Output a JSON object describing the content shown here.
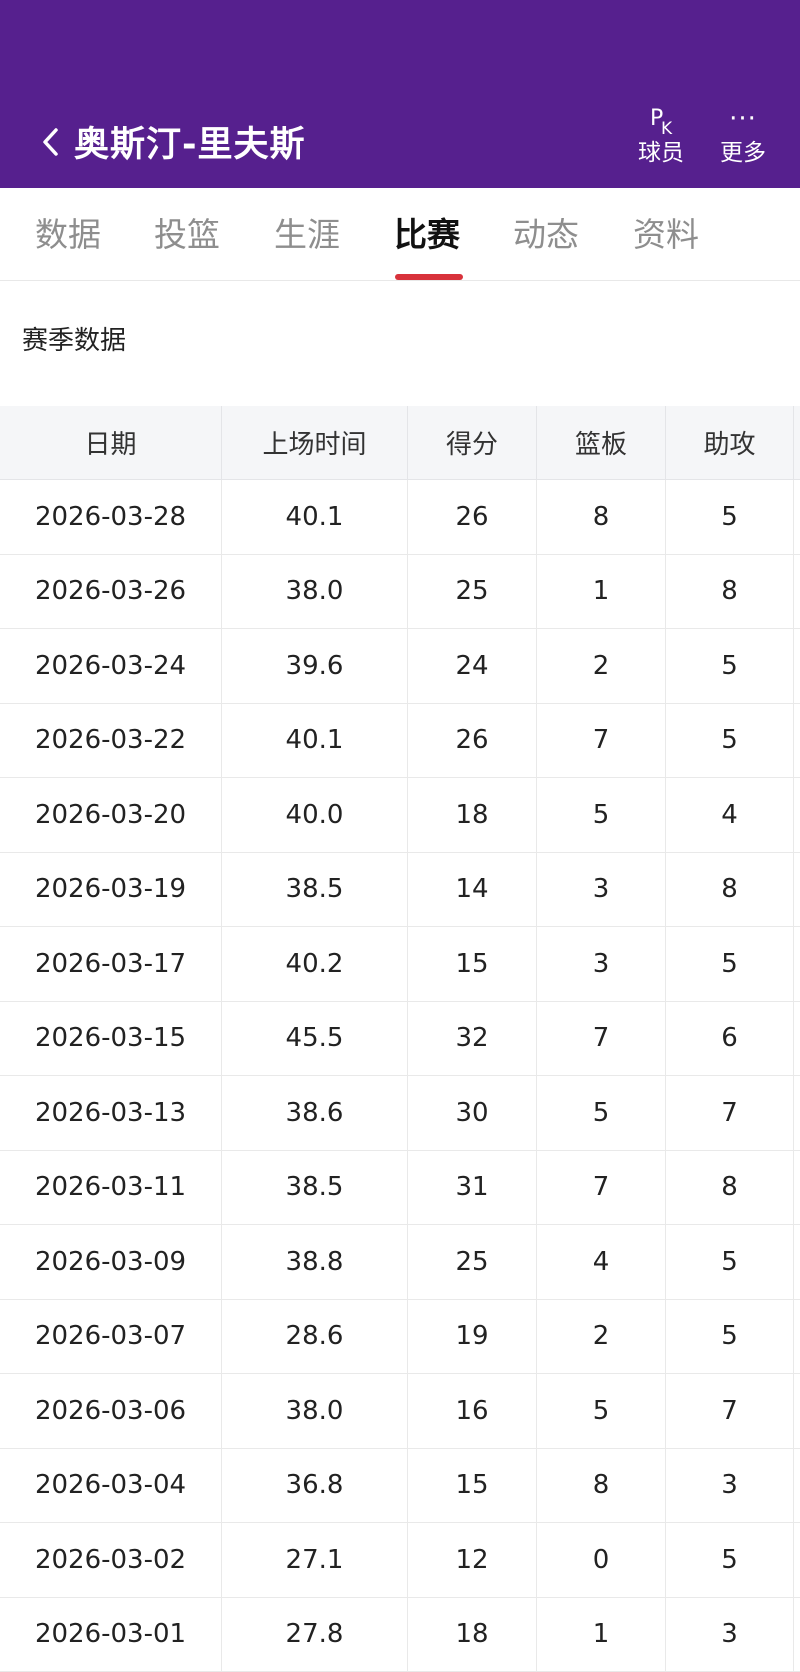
{
  "header": {
    "player_name": "奥斯汀-里夫斯",
    "actions": [
      {
        "glyph_p": "P",
        "glyph_k": "K",
        "label": "球员"
      },
      {
        "glyph": "···",
        "label": "更多"
      }
    ],
    "bg_color": "#56208e"
  },
  "tabs": [
    {
      "label": "数据",
      "active": false
    },
    {
      "label": "投篮",
      "active": false
    },
    {
      "label": "生涯",
      "active": false
    },
    {
      "label": "比赛",
      "active": true
    },
    {
      "label": "动态",
      "active": false
    },
    {
      "label": "资料",
      "active": false
    }
  ],
  "accent_color": "#d8323b",
  "section_title": "赛季数据",
  "table": {
    "columns": [
      "日期",
      "上场时间",
      "得分",
      "篮板",
      "助攻"
    ],
    "rows": [
      [
        "2026-03-28",
        "40.1",
        "26",
        "8",
        "5"
      ],
      [
        "2026-03-26",
        "38.0",
        "25",
        "1",
        "8"
      ],
      [
        "2026-03-24",
        "39.6",
        "24",
        "2",
        "5"
      ],
      [
        "2026-03-22",
        "40.1",
        "26",
        "7",
        "5"
      ],
      [
        "2026-03-20",
        "40.0",
        "18",
        "5",
        "4"
      ],
      [
        "2026-03-19",
        "38.5",
        "14",
        "3",
        "8"
      ],
      [
        "2026-03-17",
        "40.2",
        "15",
        "3",
        "5"
      ],
      [
        "2026-03-15",
        "45.5",
        "32",
        "7",
        "6"
      ],
      [
        "2026-03-13",
        "38.6",
        "30",
        "5",
        "7"
      ],
      [
        "2026-03-11",
        "38.5",
        "31",
        "7",
        "8"
      ],
      [
        "2026-03-09",
        "38.8",
        "25",
        "4",
        "5"
      ],
      [
        "2026-03-07",
        "28.6",
        "19",
        "2",
        "5"
      ],
      [
        "2026-03-06",
        "38.0",
        "16",
        "5",
        "7"
      ],
      [
        "2026-03-04",
        "36.8",
        "15",
        "8",
        "3"
      ],
      [
        "2026-03-02",
        "27.1",
        "12",
        "0",
        "5"
      ],
      [
        "2026-03-01",
        "27.8",
        "18",
        "1",
        "3"
      ]
    ]
  }
}
